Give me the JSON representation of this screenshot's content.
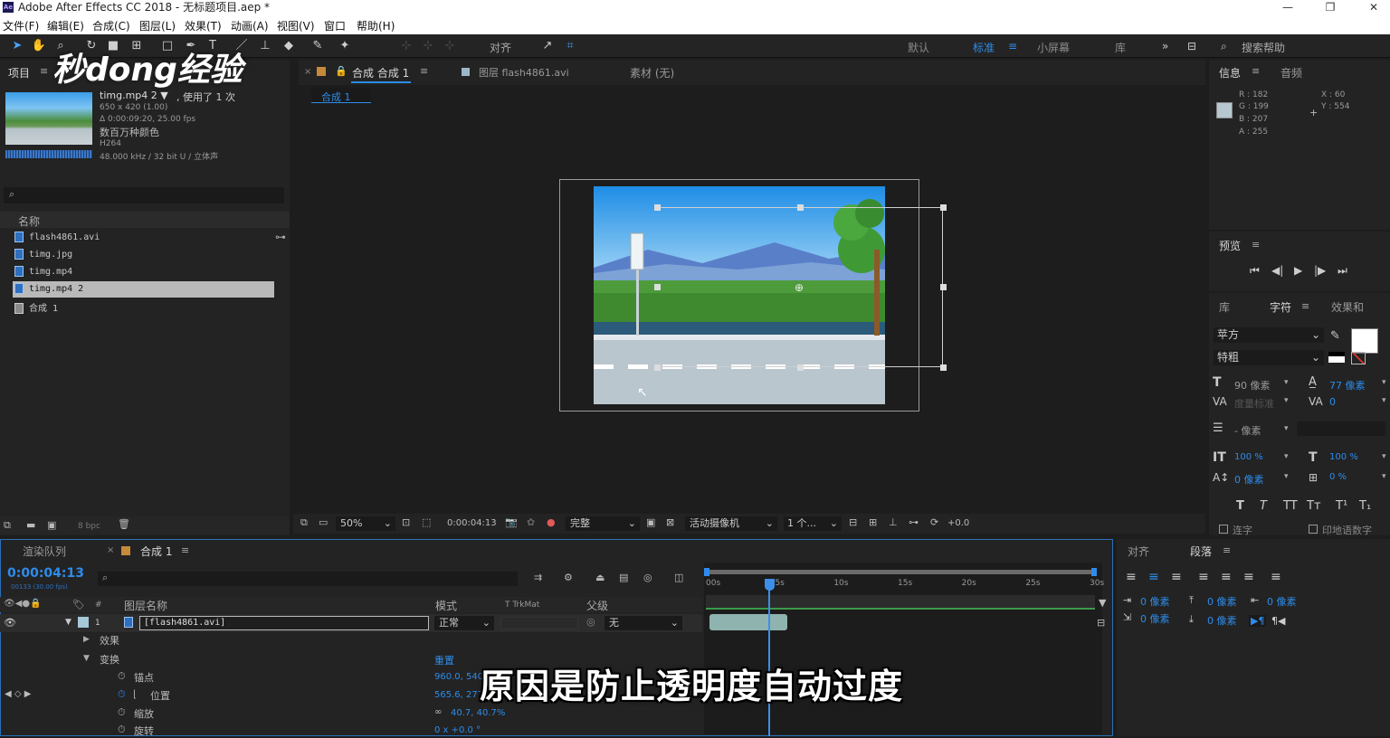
{
  "window": {
    "title": "Adobe After Effects CC 2018 - 无标题项目.aep *",
    "app_badge": "Ae"
  },
  "menu": [
    "文件(F)",
    "编辑(E)",
    "合成(C)",
    "图层(L)",
    "效果(T)",
    "动画(A)",
    "视图(V)",
    "窗口",
    "帮助(H)"
  ],
  "toolbar": {
    "align_label": "对齐",
    "workspaces": [
      "默认",
      "标准",
      "小屏幕",
      "库"
    ],
    "active_workspace": "标准",
    "search_placeholder": "搜索帮助"
  },
  "watermark": "秒dong经验",
  "project": {
    "tab": "项目",
    "selected_item": {
      "name": "timg.mp4 2 ▼",
      "usage": ", 使用了 1 次",
      "dims": "650 x 420 (1.00)",
      "duration": "Δ 0:00:09:20, 25.00 fps",
      "colors": "数百万种颜色",
      "codec": "H264",
      "audio": "48.000 kHz / 32 bit U / 立体声"
    },
    "search_placeholder": "",
    "column_name": "名称",
    "items": [
      {
        "label": "flash4861.avi",
        "type": "video"
      },
      {
        "label": "timg.jpg",
        "type": "image"
      },
      {
        "label": "timg.mp4",
        "type": "video"
      },
      {
        "label": "timg.mp4 2",
        "type": "video",
        "selected": true
      },
      {
        "label": "合成 1",
        "type": "comp"
      }
    ],
    "bpc": "8 bpc"
  },
  "viewer": {
    "tabs": [
      {
        "label": "合成 合成 1",
        "active": true
      },
      {
        "label": "图层 flash4861.avi"
      },
      {
        "label": "素材 (无)"
      }
    ],
    "breadcrumb": "合成 1",
    "zoom": "50%",
    "timecode": "0:00:04:13",
    "quality": "完整",
    "camera": "活动摄像机",
    "views": "1 个...",
    "exposure": "+0.0"
  },
  "info": {
    "tabs": [
      "信息",
      "音频"
    ],
    "r": "R : 182",
    "g": "G : 199",
    "b": "B : 207",
    "a": "A : 255",
    "x": "X : 60",
    "y": "Y : 554",
    "color": "#b6c7cf"
  },
  "preview": {
    "tab": "预览"
  },
  "character": {
    "tabs": [
      "库",
      "字符",
      "效果和"
    ],
    "font": "苹方",
    "style": "特粗",
    "size": "90 像素",
    "leading": "77 像素",
    "kerning": "度量标准",
    "tracking": "0",
    "stroke": "- 像素",
    "vscale": "100 %",
    "hscale": "100 %",
    "baseline": "0 像素",
    "tsume": "0 %",
    "styles": [
      "T",
      "T",
      "TT",
      "Tт",
      "T¹",
      "T₁"
    ],
    "ligature": "连字",
    "hindi": "印地语数字"
  },
  "paragraph": {
    "tabs": [
      "对齐",
      "段落"
    ],
    "indent_left": "0 像素",
    "indent_first": "0 像素",
    "space_before": "0 像素",
    "indent_right": "0 像素",
    "space_after": "0 像素"
  },
  "timeline": {
    "tabs": [
      "渲染队列",
      "合成 1"
    ],
    "timecode": "0:00:04:13",
    "frames": "00133 (30.00 fps)",
    "columns": {
      "name": "图层名称",
      "mode": "模式",
      "trkmat": "TrkMat",
      "parent": "父级",
      "num": "#"
    },
    "layer": {
      "index": "1",
      "name": "[flash4861.avi]",
      "mode": "正常",
      "parent": "无"
    },
    "groups": [
      "效果",
      "变换"
    ],
    "reset": "重置",
    "properties": [
      {
        "label": "锚点",
        "value": "960.0, 540.0"
      },
      {
        "label": "位置",
        "value": "565.6, 277.0"
      },
      {
        "label": "缩放",
        "value": "40.7, 40.7%"
      },
      {
        "label": "旋转",
        "value": "0 x +0.0 °"
      }
    ],
    "ruler": [
      "00s",
      "05s",
      "10s",
      "15s",
      "20s",
      "25s",
      "30s"
    ],
    "playhead_seconds": 4.43,
    "duration_seconds": 30
  },
  "subtitle": "原因是防止透明度自动过度"
}
